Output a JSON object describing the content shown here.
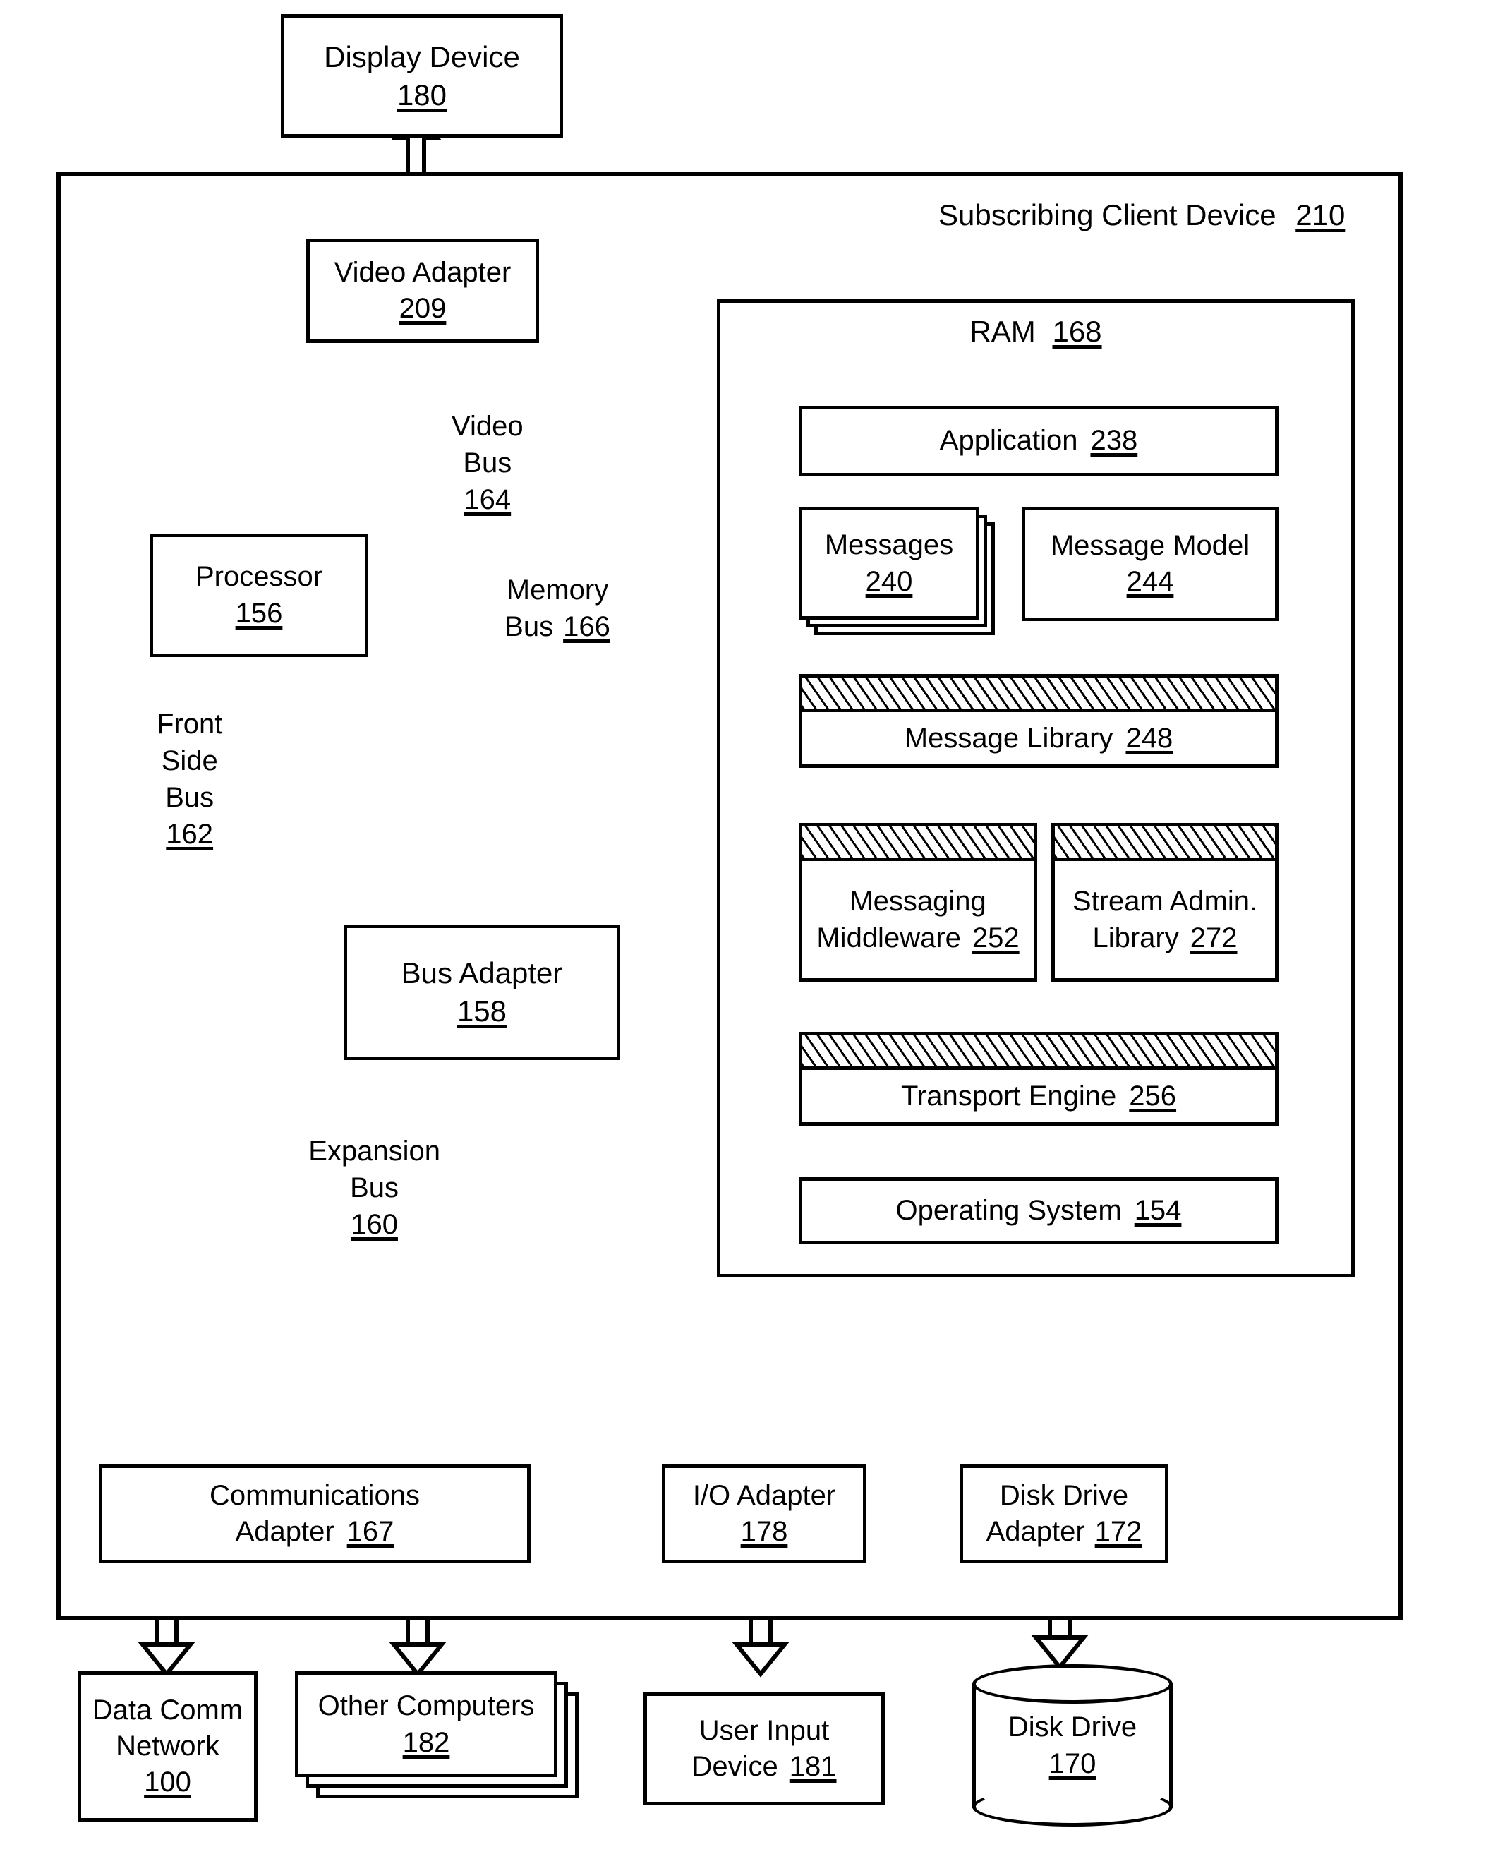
{
  "figure": {
    "type": "patent-block-diagram",
    "container": {
      "title": "Subscribing Client Device",
      "ref": "210"
    }
  },
  "nodes": {
    "display_device": {
      "label": "Display Device",
      "ref": "180"
    },
    "video_adapter": {
      "label": "Video Adapter",
      "ref": "209"
    },
    "processor": {
      "label": "Processor",
      "ref": "156"
    },
    "bus_adapter": {
      "label": "Bus Adapter",
      "ref": "158"
    },
    "ram": {
      "label": "RAM",
      "ref": "168"
    },
    "application": {
      "label": "Application",
      "ref": "238"
    },
    "messages": {
      "label": "Messages",
      "ref": "240"
    },
    "message_model": {
      "label": "Message Model",
      "ref": "244"
    },
    "message_library": {
      "label": "Message Library",
      "ref": "248"
    },
    "messaging_middleware": {
      "label1": "Messaging",
      "label2": "Middleware",
      "ref": "252"
    },
    "stream_admin_library": {
      "label1": "Stream Admin.",
      "label2": "Library",
      "ref": "272"
    },
    "transport_engine": {
      "label": "Transport Engine",
      "ref": "256"
    },
    "operating_system": {
      "label": "Operating System",
      "ref": "154"
    },
    "communications_adapter": {
      "label1": "Communications",
      "label2": "Adapter",
      "ref": "167"
    },
    "io_adapter": {
      "label": "I/O Adapter",
      "ref": "178"
    },
    "disk_drive_adapter": {
      "label1": "Disk Drive",
      "label2": "Adapter",
      "ref": "172"
    },
    "data_comm_network": {
      "label1": "Data Comm",
      "label2": "Network",
      "ref": "100"
    },
    "other_computers": {
      "label": "Other Computers",
      "ref": "182"
    },
    "user_input_device": {
      "label1": "User Input",
      "label2": "Device",
      "ref": "181"
    },
    "disk_drive": {
      "label": "Disk Drive",
      "ref": "170"
    }
  },
  "buses": {
    "video_bus": {
      "line1": "Video",
      "line2": "Bus",
      "ref": "164"
    },
    "memory_bus": {
      "line1": "Memory",
      "line2": "Bus",
      "ref": "166"
    },
    "front_side_bus": {
      "line1": "Front",
      "line2": "Side",
      "line3": "Bus",
      "ref": "162"
    },
    "expansion_bus": {
      "line1": "Expansion",
      "line2": "Bus",
      "ref": "160"
    }
  },
  "style": {
    "ink": "#000000",
    "paper": "#ffffff"
  }
}
